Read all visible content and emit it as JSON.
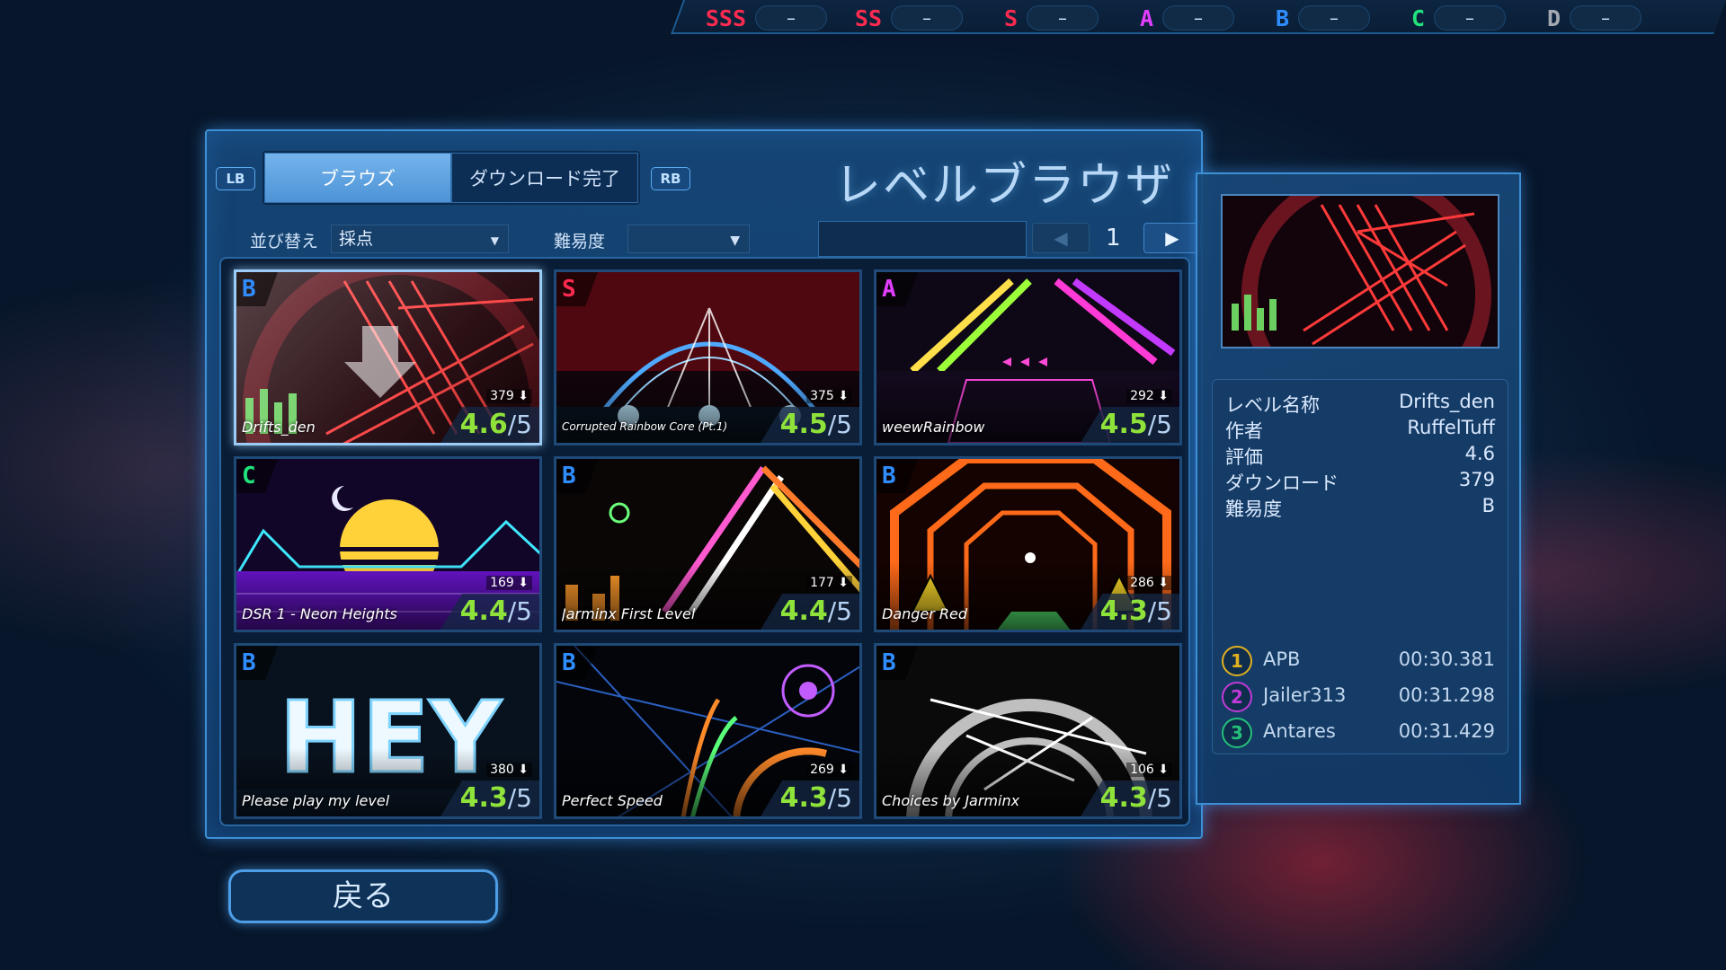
{
  "colors": {
    "accent": "#3d8fd6",
    "rating": "#8fe23a"
  },
  "ranks": [
    {
      "letter": "SSS",
      "value": "–",
      "color": "#ff2a4f"
    },
    {
      "letter": "SS",
      "value": "–",
      "color": "#ff2a4f"
    },
    {
      "letter": "S",
      "value": "–",
      "color": "#ff2a4f"
    },
    {
      "letter": "A",
      "value": "–",
      "color": "#e33dff"
    },
    {
      "letter": "B",
      "value": "–",
      "color": "#2f8dff"
    },
    {
      "letter": "C",
      "value": "–",
      "color": "#21e37b"
    },
    {
      "letter": "D",
      "value": "–",
      "color": "#a2a9b1"
    }
  ],
  "header": {
    "lb": "LB",
    "rb": "RB",
    "tabs": [
      {
        "label": "ブラウズ",
        "active": true
      },
      {
        "label": "ダウンロード完了",
        "active": false
      }
    ],
    "title": "レベルブラウザ"
  },
  "filters": {
    "sort_label": "並び替え",
    "sort_value": "採点",
    "difficulty_label": "難易度",
    "difficulty_value": "",
    "search_value": "",
    "page": "1",
    "prev_icon": "triangle-left-icon",
    "next_icon": "triangle-right-icon"
  },
  "levels": [
    {
      "name": "Drifts_den",
      "difficulty": "B",
      "diff_color": "#2f8dff",
      "downloads": "379",
      "rating": "4.6",
      "denominator": "/5",
      "selected": true,
      "theme": "red"
    },
    {
      "name": "Corrupted Rainbow Core (Pt.1)",
      "difficulty": "S",
      "diff_color": "#ff2a4f",
      "downloads": "375",
      "rating": "4.5",
      "denominator": "/5",
      "selected": false,
      "theme": "rainbow"
    },
    {
      "name": "weewRainbow",
      "difficulty": "A",
      "diff_color": "#e33dff",
      "downloads": "292",
      "rating": "4.5",
      "denominator": "/5",
      "selected": false,
      "theme": "neon"
    },
    {
      "name": "DSR 1 - Neon Heights",
      "difficulty": "C",
      "diff_color": "#21e37b",
      "downloads": "169",
      "rating": "4.4",
      "denominator": "/5",
      "selected": false,
      "theme": "sunset"
    },
    {
      "name": "Jarminx First Level",
      "difficulty": "B",
      "diff_color": "#2f8dff",
      "downloads": "177",
      "rating": "4.4",
      "denominator": "/5",
      "selected": false,
      "theme": "laser"
    },
    {
      "name": "Danger Red",
      "difficulty": "B",
      "diff_color": "#2f8dff",
      "downloads": "286",
      "rating": "4.3",
      "denominator": "/5",
      "selected": false,
      "theme": "tunnel"
    },
    {
      "name": "Please play my level",
      "difficulty": "B",
      "diff_color": "#2f8dff",
      "downloads": "380",
      "rating": "4.3",
      "denominator": "/5",
      "selected": false,
      "theme": "hey"
    },
    {
      "name": "Perfect Speed",
      "difficulty": "B",
      "diff_color": "#2f8dff",
      "downloads": "269",
      "rating": "4.3",
      "denominator": "/5",
      "selected": false,
      "theme": "speed"
    },
    {
      "name": "Choices by Jarminx",
      "difficulty": "B",
      "diff_color": "#2f8dff",
      "downloads": "106",
      "rating": "4.3",
      "denominator": "/5",
      "selected": false,
      "theme": "mono"
    }
  ],
  "hey_text": "HEY",
  "detail": {
    "rows": [
      {
        "key": "レベル名称",
        "value": "Drifts_den"
      },
      {
        "key": "作者",
        "value": "RuffelTuff"
      },
      {
        "key": "評価",
        "value": "4.6"
      },
      {
        "key": "ダウンロード",
        "value": "379"
      },
      {
        "key": "難易度",
        "value": "B"
      }
    ],
    "leaderboard": [
      {
        "rank": "1",
        "name": "APB",
        "time": "00:30.381",
        "color": "#e0b020"
      },
      {
        "rank": "2",
        "name": "Jailer313",
        "time": "00:31.298",
        "color": "#c03ad8"
      },
      {
        "rank": "3",
        "name": "Antares",
        "time": "00:31.429",
        "color": "#24c07a"
      }
    ]
  },
  "back_label": "戻る"
}
